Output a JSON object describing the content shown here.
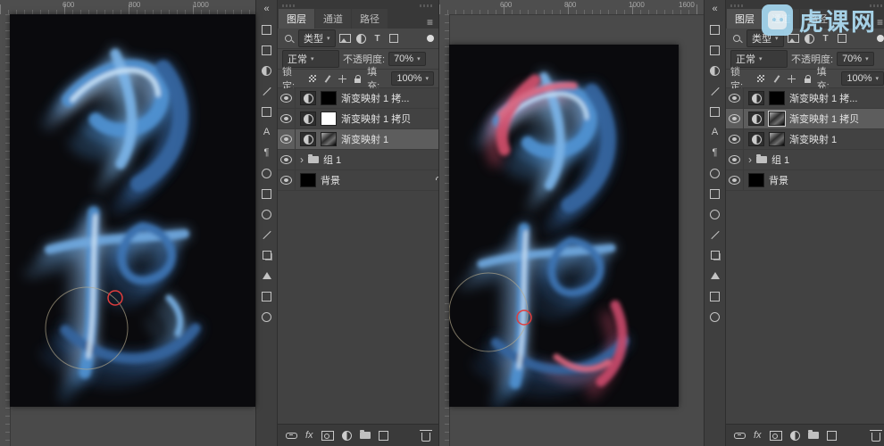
{
  "watermark": {
    "text": "虎课网",
    "color": "#afdef5"
  },
  "panel": {
    "tabs": [
      "图层",
      "通道",
      "路径"
    ],
    "filter_type_label": "类型",
    "filter_text_icon": "T",
    "blend_mode": "正常",
    "opacity_label": "不透明度:",
    "opacity_value": "70%",
    "lock_label": "锁定:",
    "fill_label": "填充:",
    "fill_value": "100%",
    "fx_label": "fx"
  },
  "left": {
    "ruler_numbers": [
      "600",
      "800",
      "1000"
    ],
    "layers": [
      {
        "name": "渐变映射 1 拷..."
      },
      {
        "name": "渐变映射 1 拷贝"
      },
      {
        "name": "渐变映射 1"
      },
      {
        "name": "组 1"
      },
      {
        "name": "背景"
      }
    ]
  },
  "right": {
    "ruler_numbers": [
      "600",
      "800",
      "1000",
      "1600"
    ],
    "layers": [
      {
        "name": "渐变映射 1 拷..."
      },
      {
        "name": "渐变映射 1 拷贝"
      },
      {
        "name": "渐变映射 1"
      },
      {
        "name": "组 1"
      },
      {
        "name": "背景"
      }
    ]
  },
  "canvas_colors": {
    "background": "#0a0a0d",
    "blue_main": "#4f92d2",
    "blue_dark": "#35659f",
    "blue_light": "#7ab4e8",
    "highlight": "#cfe8fb",
    "red_main": "#d4506c",
    "red_light": "#e4677f",
    "brush_ring": "#b3a98c",
    "brush_dot": "#e03d3d"
  }
}
